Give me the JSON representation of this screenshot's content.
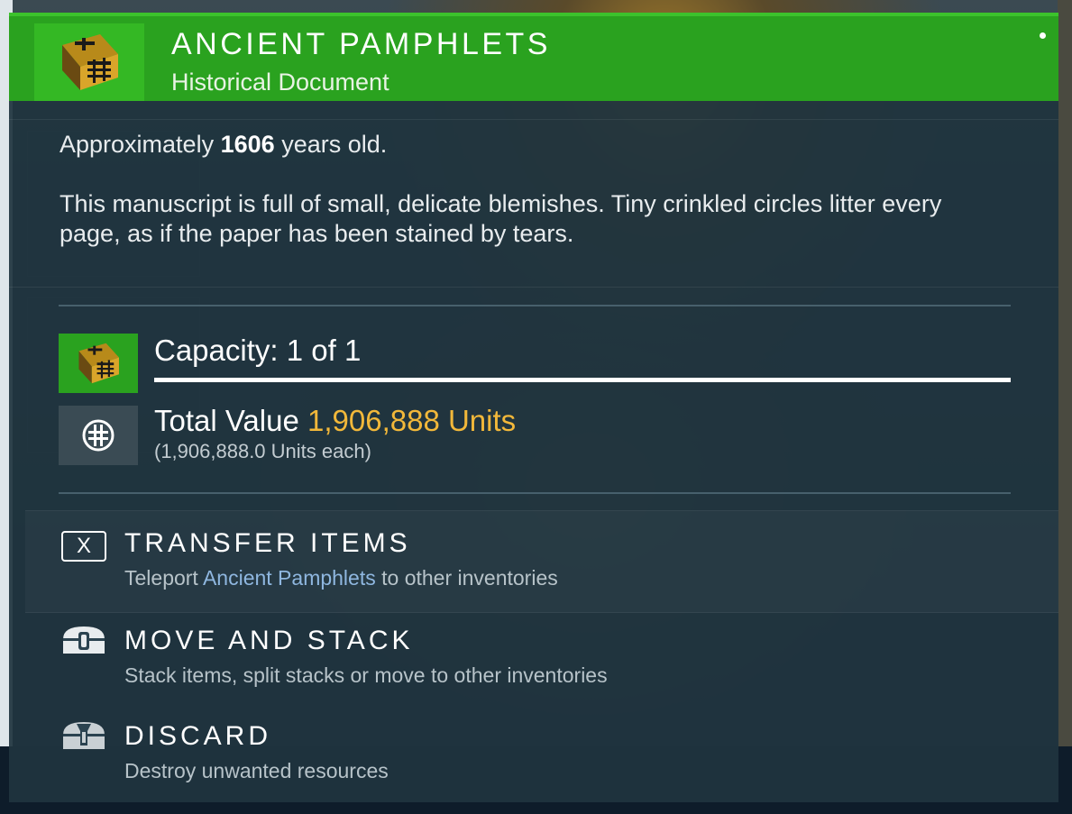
{
  "item": {
    "title": "ANCIENT PAMPHLETS",
    "subtitle": "Historical Document",
    "icon": "ancient-pamphlets-icon",
    "header_color": "#2aa21f"
  },
  "description": {
    "age_prefix": "Approximately",
    "age_value": "1606",
    "age_suffix": "years old.",
    "text": "This manuscript is full of small, delicate blemishes. Tiny crinkled circles litter every page, as if the paper has been stained by tears."
  },
  "capacity": {
    "label": "Capacity: 1 of 1",
    "fill": 1.0
  },
  "value": {
    "label_prefix": "Total Value",
    "amount": "1,906,888 Units",
    "each": "(1,906,888.0 Units each)",
    "icon": "units-currency-icon",
    "accent": "#f2b83a"
  },
  "actions": [
    {
      "key": "X",
      "title": "TRANSFER ITEMS",
      "sub_prefix": "Teleport",
      "sub_highlight": "Ancient Pamphlets",
      "sub_suffix": "to other inventories"
    },
    {
      "title": "MOVE AND STACK",
      "sub": "Stack items, split stacks or move to other inventories",
      "icon": "move-stack-icon"
    },
    {
      "title": "DISCARD",
      "sub": "Destroy unwanted resources",
      "icon": "discard-icon"
    }
  ]
}
